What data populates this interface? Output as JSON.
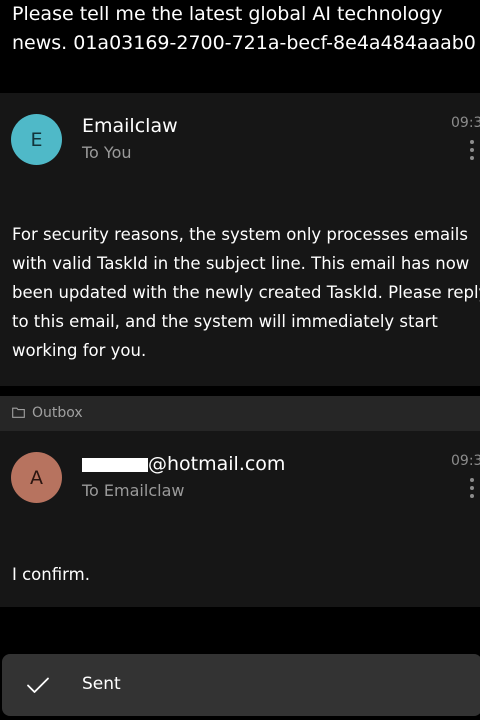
{
  "subject": {
    "line1": "Please tell me the latest global AI technology",
    "line2": "news. 01a03169-2700-721a-becf-8e4a484aaab0"
  },
  "emails": [
    {
      "avatar_letter": "E",
      "sender": "Emailclaw",
      "recipient": "To You",
      "time": "09:3",
      "body": [
        "For security reasons, the system only processes emails",
        "with valid TaskId in the subject line. This email has now",
        "been updated with the newly created TaskId. Please reply",
        "to this email, and the system will immediately start",
        "working for you."
      ]
    },
    {
      "avatar_letter": "A",
      "sender_suffix": "@hotmail.com",
      "recipient": "To Emailclaw",
      "time": "09:3",
      "body": [
        "I confirm."
      ]
    }
  ],
  "folder": {
    "label": "Outbox",
    "icon": "folder-icon"
  },
  "toast": {
    "label": "Sent",
    "icon": "check-icon"
  },
  "colors": {
    "background": "#000000",
    "card": "#161616",
    "folder_bar": "#262626",
    "toast": "#333333",
    "avatar_e": "#4fb9c8",
    "avatar_a": "#b7735f"
  }
}
